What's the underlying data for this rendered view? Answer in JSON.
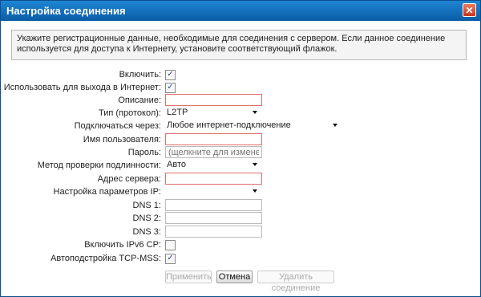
{
  "window": {
    "title": "Настройка соединения",
    "close_glyph": "✕"
  },
  "info_text": "Укажите регистрационные данные, необходимые для соединения с сервером. Если данное соединение используется для доступа к Интернету, установите соответствующий флажок.",
  "form": {
    "enable": {
      "label": "Включить:",
      "checked": true
    },
    "internet": {
      "label": "Использовать для выхода в Интернет:",
      "checked": true
    },
    "description": {
      "label": "Описание:",
      "value": ""
    },
    "protocol": {
      "label": "Тип (протокол):",
      "value": "L2TP"
    },
    "connect_via": {
      "label": "Подключаться через:",
      "value": "Любое интернет-подключение"
    },
    "username": {
      "label": "Имя пользователя:",
      "value": ""
    },
    "password": {
      "label": "Пароль:",
      "placeholder": "(щелкните для изменения)"
    },
    "auth_method": {
      "label": "Метод проверки подлинности:",
      "value": "Авто"
    },
    "server": {
      "label": "Адрес сервера:",
      "value": ""
    },
    "ip_settings": {
      "label": "Настройка параметров IP:",
      "value": ""
    },
    "dns1": {
      "label": "DNS 1:",
      "value": ""
    },
    "dns2": {
      "label": "DNS 2:",
      "value": ""
    },
    "dns3": {
      "label": "DNS 3:",
      "value": ""
    },
    "ipv6cp": {
      "label": "Включить IPv6 CP:",
      "checked": false
    },
    "tcp_mss": {
      "label": "Автоподстройка TCP-MSS:",
      "checked": true
    }
  },
  "buttons": {
    "apply": "Применить",
    "cancel": "Отмена",
    "delete": "Удалить соединение"
  },
  "check_glyph": "✓"
}
